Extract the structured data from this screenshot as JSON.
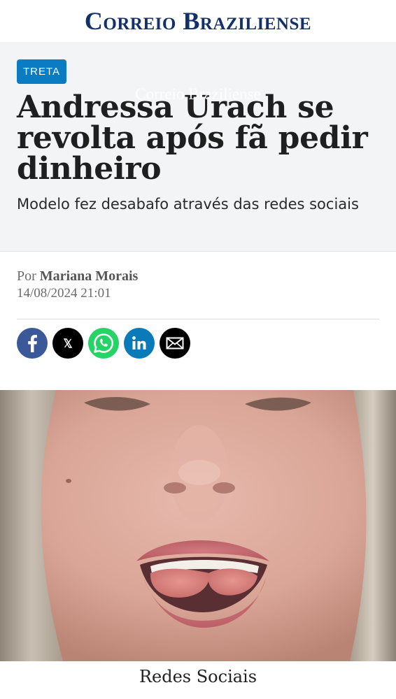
{
  "masthead": {
    "logo_text": "Correio Braziliense"
  },
  "article": {
    "ghost_title": "Correio Braziliense",
    "tag": "TRETA",
    "headline": "Andressa Urach se revolta após fã pedir dinheiro",
    "subheadline": "Modelo fez desabafo através das redes sociais",
    "byline_prefix": "Por",
    "author": "Mariana Morais",
    "date": "14/08/2024 21:01"
  },
  "share": {
    "buttons": [
      {
        "name": "facebook",
        "icon": "facebook-icon",
        "color": "#3b5998"
      },
      {
        "name": "x",
        "icon": "x-icon",
        "color": "#000000"
      },
      {
        "name": "whatsapp",
        "icon": "whatsapp-icon",
        "color": "#25d366"
      },
      {
        "name": "linkedin",
        "icon": "linkedin-icon",
        "color": "#0a7bb8"
      },
      {
        "name": "email",
        "icon": "envelope-icon",
        "color": "#000000"
      }
    ]
  },
  "photo": {
    "caption": "Redes Sociais"
  }
}
